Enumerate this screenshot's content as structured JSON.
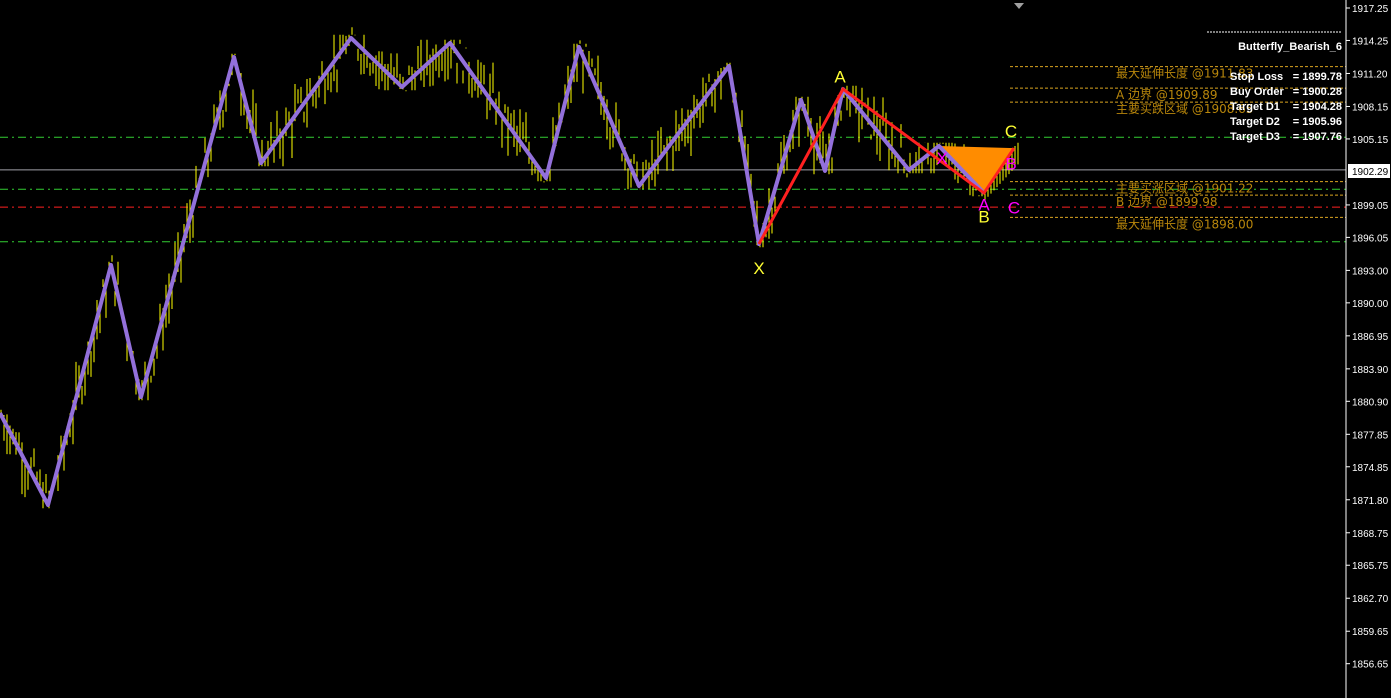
{
  "chart_data": {
    "type": "line",
    "title": "Butterfly_Bearish_6",
    "ylim": [
      1855.5,
      1918.0
    ],
    "y_ticks": [
      "1917.25",
      "1914.25",
      "1911.20",
      "1908.15",
      "1905.15",
      "1899.05",
      "1896.05",
      "1893.00",
      "1890.00",
      "1886.95",
      "1883.90",
      "1880.90",
      "1877.85",
      "1874.85",
      "1871.80",
      "1868.75",
      "1865.75",
      "1862.70",
      "1859.65",
      "1856.65"
    ],
    "current_price": "1902.29",
    "zigzag": {
      "name": "zigzag",
      "color": "#9370db",
      "points": [
        [
          0,
          1879.82
        ],
        [
          16,
          1871.32
        ],
        [
          37,
          1893.5
        ],
        [
          47,
          1881.3
        ],
        [
          78,
          1912.72
        ],
        [
          87,
          1902.92
        ],
        [
          117,
          1914.48
        ],
        [
          134,
          1909.95
        ],
        [
          150,
          1914.02
        ],
        [
          182,
          1901.54
        ],
        [
          193,
          1913.65
        ],
        [
          213,
          1900.8
        ],
        [
          243,
          1911.89
        ],
        [
          253,
          1895.44
        ],
        [
          267,
          1908.75
        ],
        [
          275,
          1902.19
        ],
        [
          281,
          1909.76
        ],
        [
          303,
          1902.28
        ],
        [
          313,
          1904.5
        ],
        [
          328,
          1900.15
        ]
      ]
    },
    "pattern": {
      "name": "XABC",
      "color": "#ff2020",
      "points": [
        [
          253,
          1895.44
        ],
        [
          281,
          1909.76
        ],
        [
          328,
          1900.15
        ],
        [
          338,
          1904.3
        ]
      ]
    },
    "triangle": {
      "color": "#ff8c00",
      "points": [
        [
          313,
          1904.5
        ],
        [
          328,
          1900.15
        ],
        [
          338,
          1904.3
        ]
      ]
    },
    "hlines": [
      {
        "price": 1905.3,
        "color": "#32cd32",
        "style": "dashdot"
      },
      {
        "price": 1900.5,
        "color": "#32cd32",
        "style": "dashdot"
      },
      {
        "price": 1898.85,
        "color": "#ff2020",
        "style": "dashdot"
      },
      {
        "price": 1895.65,
        "color": "#32cd32",
        "style": "dashdot"
      },
      {
        "price": 1902.29,
        "color": "#a0a0a8",
        "style": "solid"
      }
    ],
    "levels": [
      {
        "label": "最大延伸长度 @1911.83",
        "price": 1911.83
      },
      {
        "label": "A 边界 @1909.89",
        "price": 1909.85
      },
      {
        "label": "主要买跌区域 @1908.65",
        "price": 1908.55
      },
      {
        "label": "主要买涨区域 @1901.22",
        "price": 1901.2
      },
      {
        "label": "B 边界 @1899.98",
        "price": 1899.95
      },
      {
        "label": "最大延伸长度 @1898.00",
        "price": 1897.9
      }
    ],
    "point_labels": [
      {
        "text": "X",
        "bar": 253,
        "price": 1893.2,
        "color": "#ffff33"
      },
      {
        "text": "A",
        "bar": 280,
        "price": 1910.9,
        "color": "#ffff33"
      },
      {
        "text": "B",
        "bar": 328,
        "price": 1898.0,
        "color": "#ffff33"
      },
      {
        "text": "C",
        "bar": 337,
        "price": 1905.9,
        "color": "#ffff33"
      },
      {
        "text": "X",
        "bar": 314,
        "price": 1903.4,
        "color": "#ff00ff"
      },
      {
        "text": "A",
        "bar": 328,
        "price": 1899.1,
        "color": "#ff00ff"
      },
      {
        "text": "B",
        "bar": 337,
        "price": 1902.9,
        "color": "#ff00ff"
      },
      {
        "text": "C",
        "bar": 338,
        "price": 1898.8,
        "color": "#ff00ff"
      }
    ]
  },
  "info": {
    "title": "Butterfly_Bearish_6",
    "rows": [
      {
        "label": "Stop Loss",
        "value": "= 1899.78"
      },
      {
        "label": "Buy Order",
        "value": "= 1900.28"
      },
      {
        "label": "Target D1",
        "value": "= 1904.28"
      },
      {
        "label": "Target D2",
        "value": "= 1905.96"
      },
      {
        "label": "Target D3",
        "value": "= 1907.76"
      }
    ]
  }
}
